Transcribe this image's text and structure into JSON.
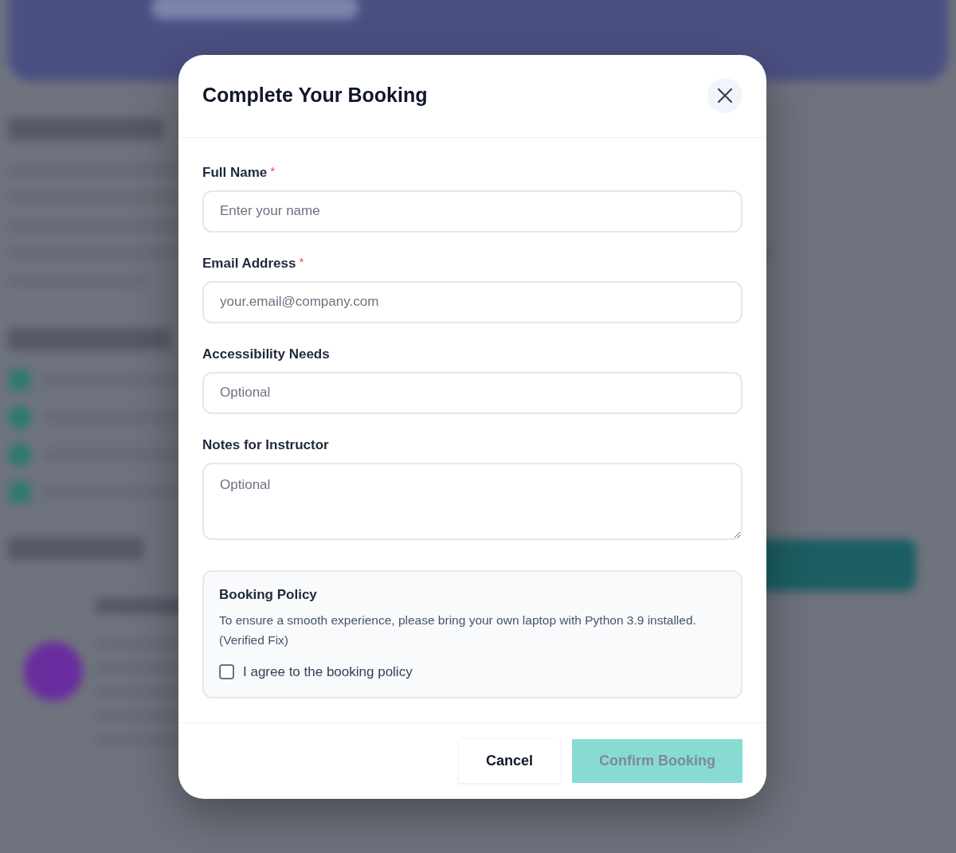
{
  "dialog": {
    "title": "Complete Your Booking"
  },
  "fields": [
    {
      "kind": "input",
      "label": "Full Name",
      "required_mark": "*",
      "placeholder": "Enter your name"
    },
    {
      "kind": "input",
      "label": "Email Address",
      "required_mark": "*",
      "placeholder": "your.email@company.com"
    },
    {
      "kind": "input",
      "label": "Accessibility Needs",
      "placeholder": "Optional"
    },
    {
      "kind": "textarea",
      "label": "Notes for Instructor",
      "placeholder": "Optional"
    }
  ],
  "policy": {
    "title": "Booking Policy",
    "text": "To ensure a smooth experience, please bring your own laptop with Python 3.9 installed. (Verified Fix)",
    "agreement": {
      "label": "I agree to the booking policy",
      "checked": false
    }
  },
  "buttons": [
    {
      "kind": "secondary",
      "label": "Cancel",
      "disabled": false
    },
    {
      "kind": "primary",
      "label": "Confirm Booking",
      "disabled": true
    }
  ]
}
